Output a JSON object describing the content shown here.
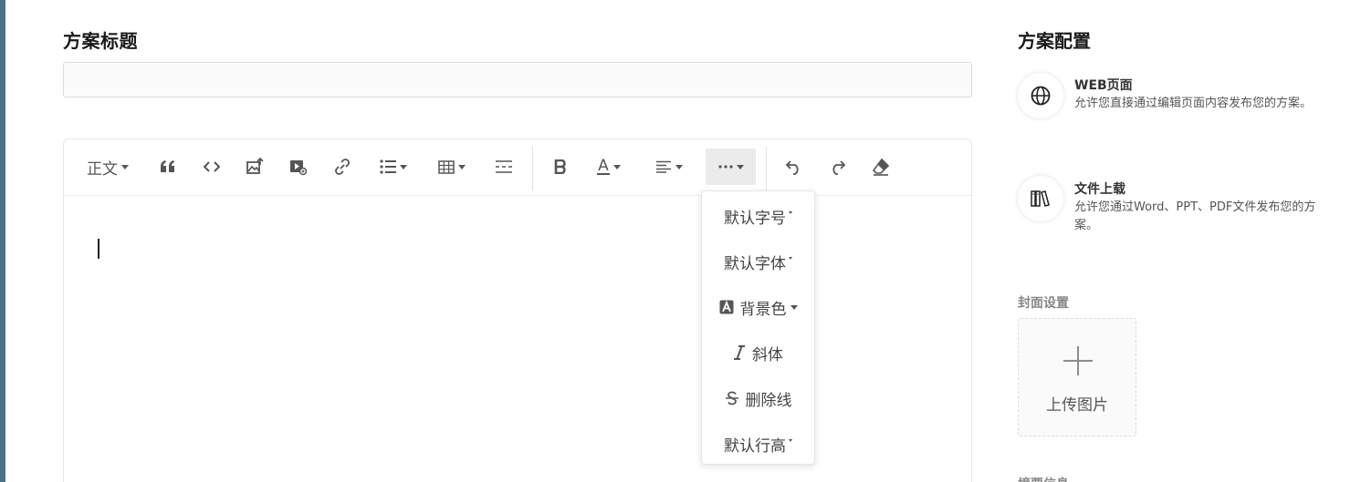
{
  "main": {
    "title_label": "方案标题",
    "title_input": {
      "value": "",
      "placeholder": ""
    },
    "toolbar": {
      "paragraph_label": "正文",
      "icons": [
        "quote-icon",
        "code-icon",
        "image-upload-icon",
        "video-icon",
        "link-icon",
        "list-icon",
        "table-icon",
        "divider-icon",
        "bold-icon",
        "font-color-icon",
        "align-icon",
        "more-icon",
        "undo-icon",
        "redo-icon",
        "eraser-icon"
      ],
      "font_color_glyph": "A"
    },
    "more_dropdown": {
      "font_size": "默认字号",
      "font_family": "默认字体",
      "bg_color": "背景色",
      "italic": "斜体",
      "strikethrough": "删除线",
      "line_height": "默认行高"
    }
  },
  "sidebar": {
    "title": "方案配置",
    "options": [
      {
        "title": "WEB页面",
        "desc": "允许您直接通过编辑页面内容发布您的方案。",
        "icon": "globe-icon"
      },
      {
        "title": "文件上载",
        "desc": "允许您通过Word、PPT、PDF文件发布您的方案。",
        "icon": "files-icon"
      }
    ],
    "cover_label": "封面设置",
    "upload_label": "上传图片",
    "summary_label": "摘要信息"
  },
  "colors": {
    "left_strip": "#4f6f86",
    "dropdown_active_bg": "#ebebeb"
  }
}
